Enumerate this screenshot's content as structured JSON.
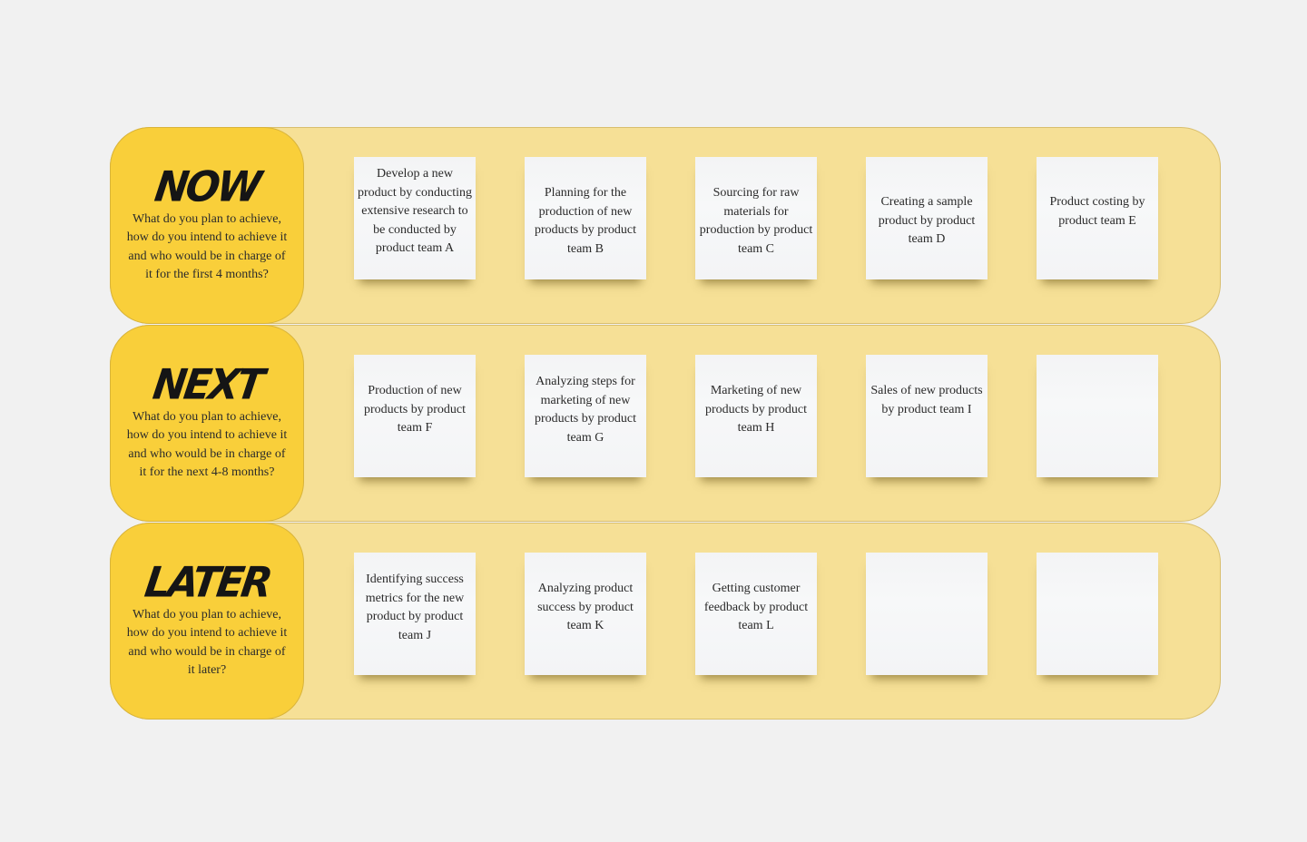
{
  "board": {
    "rows": [
      {
        "title": "NOW",
        "description": "What do you plan to achieve, how do you intend to achieve it and who would be in charge of it for the first 4 months?",
        "notes": [
          "Develop a new product by conducting extensive research to be conducted by product team A",
          "Planning for the production of new products by product team B",
          "Sourcing for raw materials for production by product team C",
          "Creating a sample product by product team D",
          "Product costing by product team E"
        ]
      },
      {
        "title": "NEXT",
        "description": "What do you plan to achieve, how do you intend to achieve it and who would be in charge of it for the next 4-8 months?",
        "notes": [
          "Production of new products by product team F",
          "Analyzing steps for marketing of new products by product team G",
          "Marketing of new products by product team H",
          "Sales of new products by product team I",
          ""
        ]
      },
      {
        "title": "LATER",
        "description": "What do you plan to achieve, how do you intend to achieve it and who would be in charge of it later?",
        "notes": [
          "Identifying success metrics for the new product by product team  J",
          "Analyzing product success by product team K",
          "Getting customer feedback by product team L",
          "",
          ""
        ]
      }
    ]
  },
  "colors": {
    "label_background": "#f9cf3a",
    "row_background": "#f6e096",
    "note_background": "#f5f6f7",
    "page_background": "#f1f1f1"
  }
}
